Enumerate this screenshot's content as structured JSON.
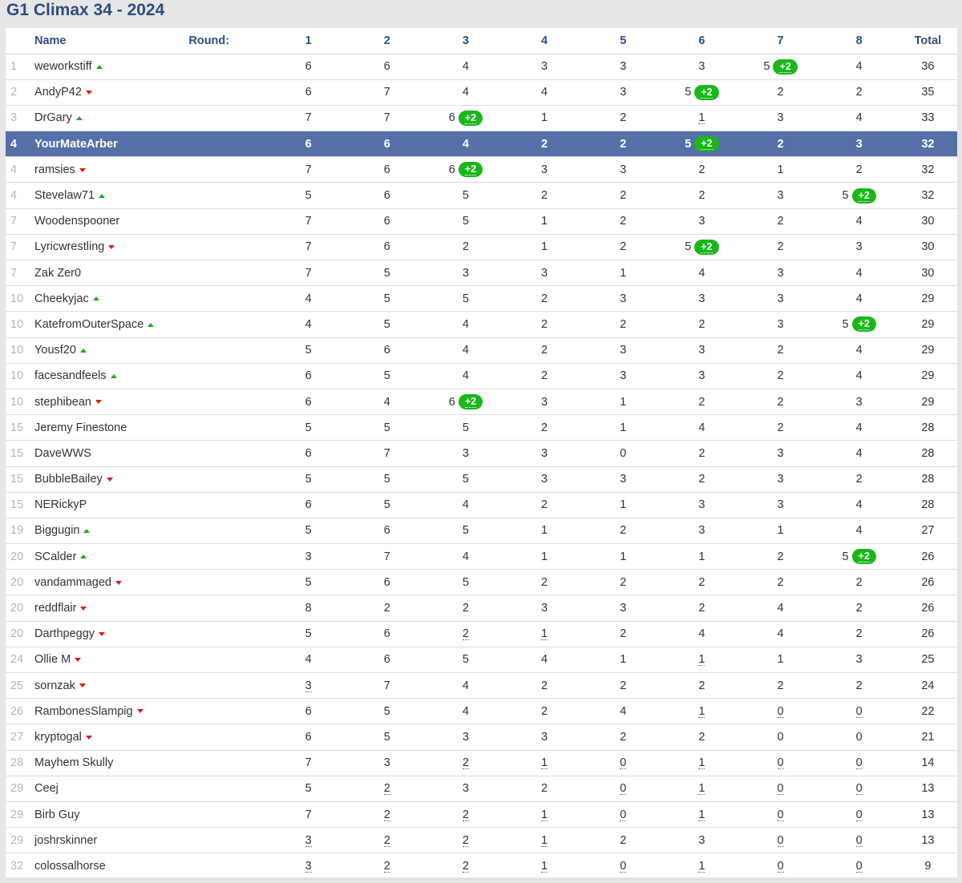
{
  "title": "G1 Climax 34 - 2024",
  "header": {
    "name": "Name",
    "round": "Round:",
    "rounds": [
      "1",
      "2",
      "3",
      "4",
      "5",
      "6",
      "7",
      "8"
    ],
    "total": "Total"
  },
  "colors": {
    "title": "#2e4d80",
    "highlight_row": "#5470a7",
    "badge": "#18b818",
    "up": "#1eaa1e",
    "down": "#e01818"
  },
  "rows": [
    {
      "rank": "1",
      "name": "weworkstiff",
      "trend": "up",
      "scores": [
        [
          "6"
        ],
        [
          "6"
        ],
        [
          "4"
        ],
        [
          "3"
        ],
        [
          "3"
        ],
        [
          "3"
        ],
        [
          "5",
          "+2"
        ],
        [
          "4"
        ]
      ],
      "total": "36"
    },
    {
      "rank": "2",
      "name": "AndyP42",
      "trend": "down",
      "scores": [
        [
          "6"
        ],
        [
          "7"
        ],
        [
          "4"
        ],
        [
          "4"
        ],
        [
          "3"
        ],
        [
          "5",
          "+2"
        ],
        [
          "2"
        ],
        [
          "2"
        ]
      ],
      "total": "35"
    },
    {
      "rank": "3",
      "name": "DrGary",
      "trend": "up",
      "scores": [
        [
          "7"
        ],
        [
          "7"
        ],
        [
          "6",
          "+2"
        ],
        [
          "1"
        ],
        [
          "2"
        ],
        [
          "1",
          "",
          "d"
        ],
        [
          "3"
        ],
        [
          "4"
        ]
      ],
      "total": "33"
    },
    {
      "rank": "4",
      "name": "YourMateArber",
      "trend": "",
      "highlight": true,
      "scores": [
        [
          "6"
        ],
        [
          "6"
        ],
        [
          "4"
        ],
        [
          "2"
        ],
        [
          "2"
        ],
        [
          "5",
          "+2"
        ],
        [
          "2"
        ],
        [
          "3"
        ]
      ],
      "total": "32"
    },
    {
      "rank": "4",
      "name": "ramsies",
      "trend": "down",
      "scores": [
        [
          "7"
        ],
        [
          "6"
        ],
        [
          "6",
          "+2"
        ],
        [
          "3"
        ],
        [
          "3"
        ],
        [
          "2"
        ],
        [
          "1"
        ],
        [
          "2"
        ]
      ],
      "total": "32"
    },
    {
      "rank": "4",
      "name": "Stevelaw71",
      "trend": "up",
      "scores": [
        [
          "5"
        ],
        [
          "6"
        ],
        [
          "5"
        ],
        [
          "2"
        ],
        [
          "2"
        ],
        [
          "2"
        ],
        [
          "3"
        ],
        [
          "5",
          "+2"
        ]
      ],
      "total": "32"
    },
    {
      "rank": "7",
      "name": "Woodenspooner",
      "trend": "",
      "scores": [
        [
          "7"
        ],
        [
          "6"
        ],
        [
          "5"
        ],
        [
          "1"
        ],
        [
          "2"
        ],
        [
          "3"
        ],
        [
          "2"
        ],
        [
          "4"
        ]
      ],
      "total": "30"
    },
    {
      "rank": "7",
      "name": "Lyricwrestling",
      "trend": "down",
      "scores": [
        [
          "7"
        ],
        [
          "6"
        ],
        [
          "2"
        ],
        [
          "1"
        ],
        [
          "2"
        ],
        [
          "5",
          "+2"
        ],
        [
          "2"
        ],
        [
          "3"
        ]
      ],
      "total": "30"
    },
    {
      "rank": "7",
      "name": "Zak Zer0",
      "trend": "",
      "scores": [
        [
          "7"
        ],
        [
          "5"
        ],
        [
          "3"
        ],
        [
          "3"
        ],
        [
          "1"
        ],
        [
          "4"
        ],
        [
          "3"
        ],
        [
          "4"
        ]
      ],
      "total": "30"
    },
    {
      "rank": "10",
      "name": "Cheekyjac",
      "trend": "up",
      "scores": [
        [
          "4"
        ],
        [
          "5"
        ],
        [
          "5"
        ],
        [
          "2"
        ],
        [
          "3"
        ],
        [
          "3"
        ],
        [
          "3"
        ],
        [
          "4"
        ]
      ],
      "total": "29"
    },
    {
      "rank": "10",
      "name": "KatefromOuterSpace",
      "trend": "up",
      "scores": [
        [
          "4"
        ],
        [
          "5"
        ],
        [
          "4"
        ],
        [
          "2"
        ],
        [
          "2"
        ],
        [
          "2"
        ],
        [
          "3"
        ],
        [
          "5",
          "+2"
        ]
      ],
      "total": "29"
    },
    {
      "rank": "10",
      "name": "Yousf20",
      "trend": "up",
      "scores": [
        [
          "5"
        ],
        [
          "6"
        ],
        [
          "4"
        ],
        [
          "2"
        ],
        [
          "3"
        ],
        [
          "3"
        ],
        [
          "2"
        ],
        [
          "4"
        ]
      ],
      "total": "29"
    },
    {
      "rank": "10",
      "name": "facesandfeels",
      "trend": "up",
      "scores": [
        [
          "6"
        ],
        [
          "5"
        ],
        [
          "4"
        ],
        [
          "2"
        ],
        [
          "3"
        ],
        [
          "3"
        ],
        [
          "2"
        ],
        [
          "4"
        ]
      ],
      "total": "29"
    },
    {
      "rank": "10",
      "name": "stephibean",
      "trend": "down",
      "scores": [
        [
          "6"
        ],
        [
          "4"
        ],
        [
          "6",
          "+2"
        ],
        [
          "3"
        ],
        [
          "1"
        ],
        [
          "2"
        ],
        [
          "2"
        ],
        [
          "3"
        ]
      ],
      "total": "29"
    },
    {
      "rank": "15",
      "name": "Jeremy Finestone",
      "trend": "",
      "scores": [
        [
          "5"
        ],
        [
          "5"
        ],
        [
          "5"
        ],
        [
          "2"
        ],
        [
          "1"
        ],
        [
          "4"
        ],
        [
          "2"
        ],
        [
          "4"
        ]
      ],
      "total": "28"
    },
    {
      "rank": "15",
      "name": "DaveWWS",
      "trend": "",
      "scores": [
        [
          "6"
        ],
        [
          "7"
        ],
        [
          "3"
        ],
        [
          "3"
        ],
        [
          "0"
        ],
        [
          "2"
        ],
        [
          "3"
        ],
        [
          "4"
        ]
      ],
      "total": "28"
    },
    {
      "rank": "15",
      "name": "BubbleBailey",
      "trend": "down",
      "scores": [
        [
          "5"
        ],
        [
          "5"
        ],
        [
          "5"
        ],
        [
          "3"
        ],
        [
          "3"
        ],
        [
          "2"
        ],
        [
          "3"
        ],
        [
          "2"
        ]
      ],
      "total": "28"
    },
    {
      "rank": "15",
      "name": "NERickyP",
      "trend": "",
      "scores": [
        [
          "6"
        ],
        [
          "5"
        ],
        [
          "4"
        ],
        [
          "2"
        ],
        [
          "1"
        ],
        [
          "3"
        ],
        [
          "3"
        ],
        [
          "4"
        ]
      ],
      "total": "28"
    },
    {
      "rank": "19",
      "name": "Biggugin",
      "trend": "up",
      "scores": [
        [
          "5"
        ],
        [
          "6"
        ],
        [
          "5"
        ],
        [
          "1"
        ],
        [
          "2"
        ],
        [
          "3"
        ],
        [
          "1"
        ],
        [
          "4"
        ]
      ],
      "total": "27"
    },
    {
      "rank": "20",
      "name": "SCalder",
      "trend": "up",
      "scores": [
        [
          "3"
        ],
        [
          "7"
        ],
        [
          "4"
        ],
        [
          "1"
        ],
        [
          "1"
        ],
        [
          "1"
        ],
        [
          "2"
        ],
        [
          "5",
          "+2"
        ]
      ],
      "total": "26"
    },
    {
      "rank": "20",
      "name": "vandammaged",
      "trend": "down",
      "scores": [
        [
          "5"
        ],
        [
          "6"
        ],
        [
          "5"
        ],
        [
          "2"
        ],
        [
          "2"
        ],
        [
          "2"
        ],
        [
          "2"
        ],
        [
          "2"
        ]
      ],
      "total": "26"
    },
    {
      "rank": "20",
      "name": "reddflair",
      "trend": "down",
      "scores": [
        [
          "8"
        ],
        [
          "2"
        ],
        [
          "2"
        ],
        [
          "3"
        ],
        [
          "3"
        ],
        [
          "2"
        ],
        [
          "4"
        ],
        [
          "2"
        ]
      ],
      "total": "26"
    },
    {
      "rank": "20",
      "name": "Darthpeggy",
      "trend": "down",
      "scores": [
        [
          "5"
        ],
        [
          "6"
        ],
        [
          "2",
          "",
          "d"
        ],
        [
          "1",
          "",
          "d"
        ],
        [
          "2"
        ],
        [
          "4"
        ],
        [
          "4"
        ],
        [
          "2"
        ]
      ],
      "total": "26"
    },
    {
      "rank": "24",
      "name": "Ollie M",
      "trend": "down",
      "scores": [
        [
          "4"
        ],
        [
          "6"
        ],
        [
          "5"
        ],
        [
          "4"
        ],
        [
          "1"
        ],
        [
          "1",
          "",
          "d"
        ],
        [
          "1"
        ],
        [
          "3"
        ]
      ],
      "total": "25"
    },
    {
      "rank": "25",
      "name": "sornzak",
      "trend": "down",
      "scores": [
        [
          "3",
          "",
          "d"
        ],
        [
          "7"
        ],
        [
          "4"
        ],
        [
          "2"
        ],
        [
          "2"
        ],
        [
          "2"
        ],
        [
          "2"
        ],
        [
          "2"
        ]
      ],
      "total": "24"
    },
    {
      "rank": "26",
      "name": "RambonesSlampig",
      "trend": "down",
      "scores": [
        [
          "6"
        ],
        [
          "5"
        ],
        [
          "4"
        ],
        [
          "2"
        ],
        [
          "4"
        ],
        [
          "1",
          "",
          "d"
        ],
        [
          "0",
          "",
          "d"
        ],
        [
          "0",
          "",
          "d"
        ]
      ],
      "total": "22"
    },
    {
      "rank": "27",
      "name": "kryptogal",
      "trend": "down",
      "scores": [
        [
          "6"
        ],
        [
          "5"
        ],
        [
          "3"
        ],
        [
          "3"
        ],
        [
          "2"
        ],
        [
          "2"
        ],
        [
          "0"
        ],
        [
          "0"
        ]
      ],
      "total": "21"
    },
    {
      "rank": "28",
      "name": "Mayhem Skully",
      "trend": "",
      "scores": [
        [
          "7"
        ],
        [
          "3"
        ],
        [
          "2",
          "",
          "d"
        ],
        [
          "1",
          "",
          "d"
        ],
        [
          "0",
          "",
          "d"
        ],
        [
          "1",
          "",
          "d"
        ],
        [
          "0",
          "",
          "d"
        ],
        [
          "0",
          "",
          "d"
        ]
      ],
      "total": "14"
    },
    {
      "rank": "29",
      "name": "Ceej",
      "trend": "",
      "scores": [
        [
          "5"
        ],
        [
          "2",
          "",
          "d"
        ],
        [
          "3"
        ],
        [
          "2"
        ],
        [
          "0",
          "",
          "d"
        ],
        [
          "1",
          "",
          "d"
        ],
        [
          "0",
          "",
          "d"
        ],
        [
          "0",
          "",
          "d"
        ]
      ],
      "total": "13"
    },
    {
      "rank": "29",
      "name": "Birb Guy",
      "trend": "",
      "scores": [
        [
          "7"
        ],
        [
          "2",
          "",
          "d"
        ],
        [
          "2",
          "",
          "d"
        ],
        [
          "1",
          "",
          "d"
        ],
        [
          "0",
          "",
          "d"
        ],
        [
          "1",
          "",
          "d"
        ],
        [
          "0",
          "",
          "d"
        ],
        [
          "0",
          "",
          "d"
        ]
      ],
      "total": "13"
    },
    {
      "rank": "29",
      "name": "joshrskinner",
      "trend": "",
      "scores": [
        [
          "3",
          "",
          "d"
        ],
        [
          "2",
          "",
          "d"
        ],
        [
          "2",
          "",
          "d"
        ],
        [
          "1",
          "",
          "d"
        ],
        [
          "2"
        ],
        [
          "3"
        ],
        [
          "0",
          "",
          "d"
        ],
        [
          "0",
          "",
          "d"
        ]
      ],
      "total": "13"
    },
    {
      "rank": "32",
      "name": "colossalhorse",
      "trend": "",
      "scores": [
        [
          "3",
          "",
          "d"
        ],
        [
          "2",
          "",
          "d"
        ],
        [
          "2",
          "",
          "d"
        ],
        [
          "1",
          "",
          "d"
        ],
        [
          "0",
          "",
          "d"
        ],
        [
          "1",
          "",
          "d"
        ],
        [
          "0",
          "",
          "d"
        ],
        [
          "0",
          "",
          "d"
        ]
      ],
      "total": "9"
    }
  ]
}
